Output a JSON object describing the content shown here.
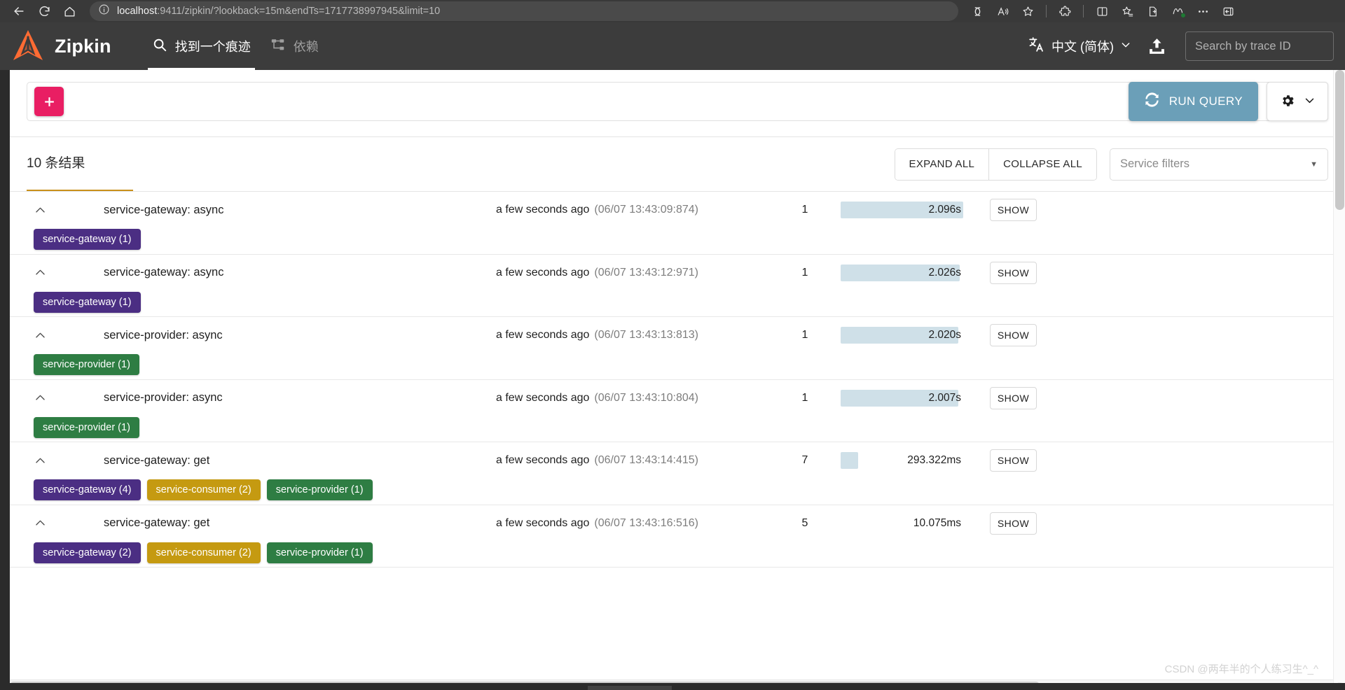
{
  "browser": {
    "url_host": "localhost",
    "url_rest": ":9411/zipkin/?lookback=15m&endTs=1717738997945&limit=10",
    "back_icon": "back-arrow-icon",
    "reload_icon": "reload-icon",
    "home_icon": "home-icon",
    "info_icon": "site-info-icon",
    "right_icons": [
      "copilot-icon",
      "read-aloud-icon",
      "favorite-star-icon",
      "extensions-icon",
      "split-screen-icon",
      "collections-icon",
      "add-to-favorites-icon",
      "browser-essentials-icon",
      "more-options-icon",
      "sidebar-toggle-icon"
    ]
  },
  "header": {
    "brand": "Zipkin",
    "logo_color": "#ff6b33",
    "tabs": [
      {
        "label": "找到一个痕迹",
        "icon": "search-icon",
        "active": true
      },
      {
        "label": "依赖",
        "icon": "dependency-tree-icon",
        "active": false
      }
    ],
    "language": {
      "icon": "translate-icon",
      "value": "中文 (简体)",
      "caret": "chevron-down-icon"
    },
    "upload_icon": "upload-icon",
    "trace_search_placeholder": "Search by trace ID",
    "trace_search_value": ""
  },
  "query_toolbar": {
    "add_criteria_label": "+",
    "run_query_label": "RUN QUERY",
    "run_query_icon": "refresh-icon",
    "run_query_color": "#6b9fb8",
    "settings_icon": "gear-icon",
    "settings_caret": "chevron-down-icon"
  },
  "results_header": {
    "count_text": "10 条结果",
    "underline_color": "#c9901a",
    "expand_all": "EXPAND ALL",
    "collapse_all": "COLLAPSE ALL",
    "service_filters_placeholder": "Service filters",
    "service_filters_caret": "dropdown-caret-icon"
  },
  "service_colors": {
    "service-gateway": "#4b2e83",
    "service-consumer": "#c59a11",
    "service-provider": "#2e7d43"
  },
  "traces": [
    {
      "chevron": "chevron-up-icon",
      "name": "service-gateway: async",
      "relative_time": "a few seconds ago",
      "timestamp": "(06/07 13:43:09:874)",
      "span_count": "1",
      "duration": "2.096s",
      "bar_pct": 100,
      "show_label": "SHOW",
      "badges": [
        {
          "label": "service-gateway (1)",
          "service": "service-gateway"
        }
      ]
    },
    {
      "chevron": "chevron-up-icon",
      "name": "service-gateway: async",
      "relative_time": "a few seconds ago",
      "timestamp": "(06/07 13:43:12:971)",
      "span_count": "1",
      "duration": "2.026s",
      "bar_pct": 97,
      "show_label": "SHOW",
      "badges": [
        {
          "label": "service-gateway (1)",
          "service": "service-gateway"
        }
      ]
    },
    {
      "chevron": "chevron-up-icon",
      "name": "service-provider: async",
      "relative_time": "a few seconds ago",
      "timestamp": "(06/07 13:43:13:813)",
      "span_count": "1",
      "duration": "2.020s",
      "bar_pct": 96,
      "show_label": "SHOW",
      "badges": [
        {
          "label": "service-provider (1)",
          "service": "service-provider"
        }
      ]
    },
    {
      "chevron": "chevron-up-icon",
      "name": "service-provider: async",
      "relative_time": "a few seconds ago",
      "timestamp": "(06/07 13:43:10:804)",
      "span_count": "1",
      "duration": "2.007s",
      "bar_pct": 96,
      "show_label": "SHOW",
      "badges": [
        {
          "label": "service-provider (1)",
          "service": "service-provider"
        }
      ]
    },
    {
      "chevron": "chevron-up-icon",
      "name": "service-gateway: get",
      "relative_time": "a few seconds ago",
      "timestamp": "(06/07 13:43:14:415)",
      "span_count": "7",
      "duration": "293.322ms",
      "bar_pct": 14,
      "show_label": "SHOW",
      "badges": [
        {
          "label": "service-gateway (4)",
          "service": "service-gateway"
        },
        {
          "label": "service-consumer (2)",
          "service": "service-consumer"
        },
        {
          "label": "service-provider (1)",
          "service": "service-provider"
        }
      ]
    },
    {
      "chevron": "chevron-up-icon",
      "name": "service-gateway: get",
      "relative_time": "a few seconds ago",
      "timestamp": "(06/07 13:43:16:516)",
      "span_count": "5",
      "duration": "10.075ms",
      "bar_pct": 0,
      "show_label": "SHOW",
      "badges": [
        {
          "label": "service-gateway (2)",
          "service": "service-gateway"
        },
        {
          "label": "service-consumer (2)",
          "service": "service-consumer"
        },
        {
          "label": "service-provider (1)",
          "service": "service-provider"
        }
      ]
    }
  ],
  "watermark": "CSDN @两年半的个人练习生^_^"
}
